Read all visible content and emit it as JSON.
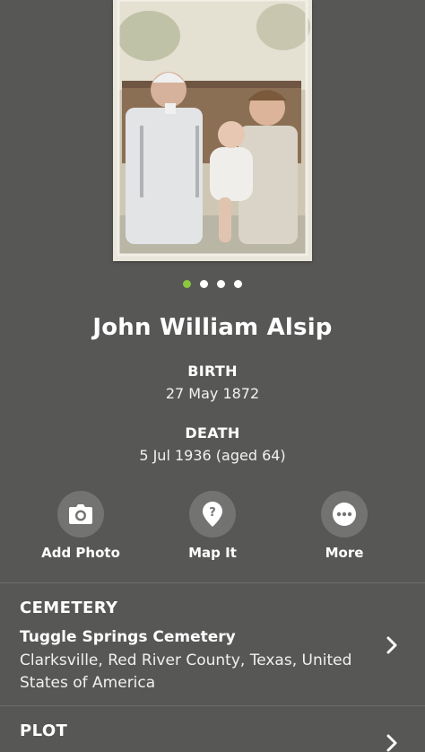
{
  "gallery": {
    "photo_alt": "Family photo",
    "dot_count": 4,
    "active_dot": 0
  },
  "person": {
    "name": "John William Alsip",
    "birth_label": "BIRTH",
    "birth_date": "27 May 1872",
    "death_label": "DEATH",
    "death_date": "5 Jul 1936 (aged 64)"
  },
  "actions": {
    "add_photo": {
      "label": "Add Photo",
      "icon": "camera-icon"
    },
    "map_it": {
      "label": "Map It",
      "icon": "map-pin-icon"
    },
    "more": {
      "label": "More",
      "icon": "more-dots-icon"
    }
  },
  "cemetery": {
    "title": "CEMETERY",
    "name": "Tuggle Springs Cemetery",
    "location": "Clarksville, Red River County, Texas, United States of America"
  },
  "plot": {
    "title": "PLOT"
  },
  "colors": {
    "background": "#575756",
    "active_dot": "#8dc63f",
    "icon_circle": "#737372"
  }
}
